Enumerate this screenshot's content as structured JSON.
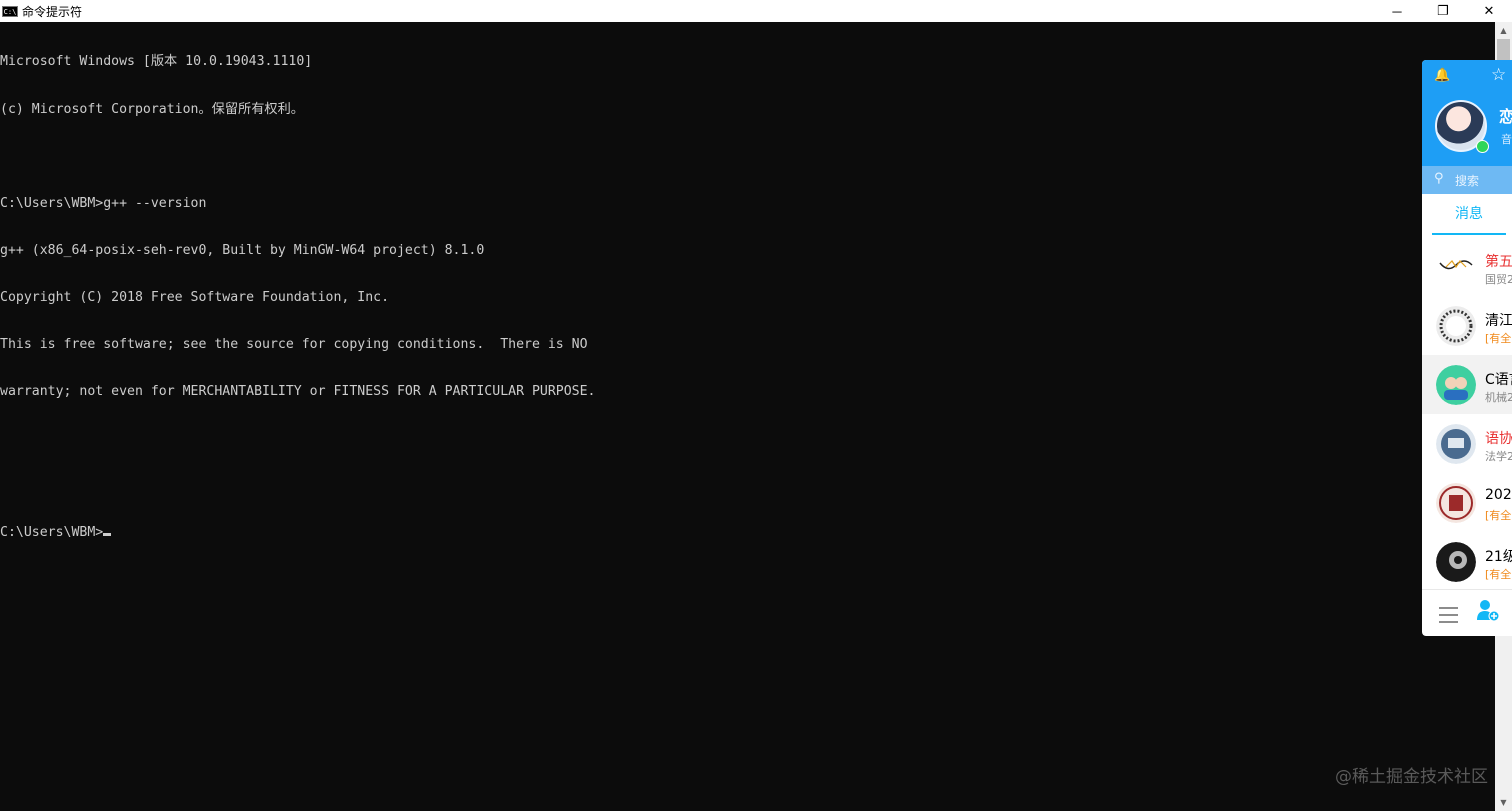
{
  "window": {
    "title": "命令提示符",
    "icon_label": "C:\\",
    "controls": {
      "minimize": "─",
      "restore": "❐",
      "close": "✕"
    }
  },
  "console": {
    "lines": [
      "Microsoft Windows [版本 10.0.19043.1110]",
      "(c) Microsoft Corporation。保留所有权利。",
      "",
      "C:\\Users\\WBM>g++ --version",
      "g++ (x86_64-posix-seh-rev0, Built by MinGW-W64 project) 8.1.0",
      "Copyright (C) 2018 Free Software Foundation, Inc.",
      "This is free software; see the source for copying conditions.  There is NO",
      "warranty; not even for MERCHANTABILITY or FITNESS FOR A PARTICULAR PURPOSE.",
      "",
      "",
      "C:\\Users\\WBM>"
    ],
    "text_color": "#cccccc",
    "background": "#0c0c0c"
  },
  "scrollbar": {
    "up": "▲",
    "down": "▼"
  },
  "watermark": "@稀土掘金技术社区",
  "qq": {
    "header_color": "#1e9ef5",
    "nickname": "恋",
    "signature": "音",
    "search_placeholder": "搜索",
    "tab_messages": "消息",
    "icons": {
      "bell": "🔔",
      "star": "☆",
      "search": "⚲"
    },
    "items": [
      {
        "name": "第五",
        "sub": "国贸2",
        "name_color": "red",
        "sub_color": "gray",
        "avatar_color": "#ffffff"
      },
      {
        "name": "清江",
        "sub": "[有全",
        "name_color": "black",
        "sub_color": "orange",
        "avatar_color": "#ececec"
      },
      {
        "name": "C语言",
        "sub": "机械2",
        "name_color": "black",
        "sub_color": "gray",
        "avatar_color": "#3ecfa0"
      },
      {
        "name": "语协",
        "sub": "法学2",
        "name_color": "red",
        "sub_color": "gray",
        "avatar_color": "#4a6b8f"
      },
      {
        "name": "202",
        "sub": "[有全",
        "name_color": "black",
        "sub_color": "orange",
        "avatar_color": "#9c2a2a"
      },
      {
        "name": "21级",
        "sub": "[有全",
        "name_color": "black",
        "sub_color": "orange",
        "avatar_color": "#1a1a1a"
      }
    ]
  }
}
